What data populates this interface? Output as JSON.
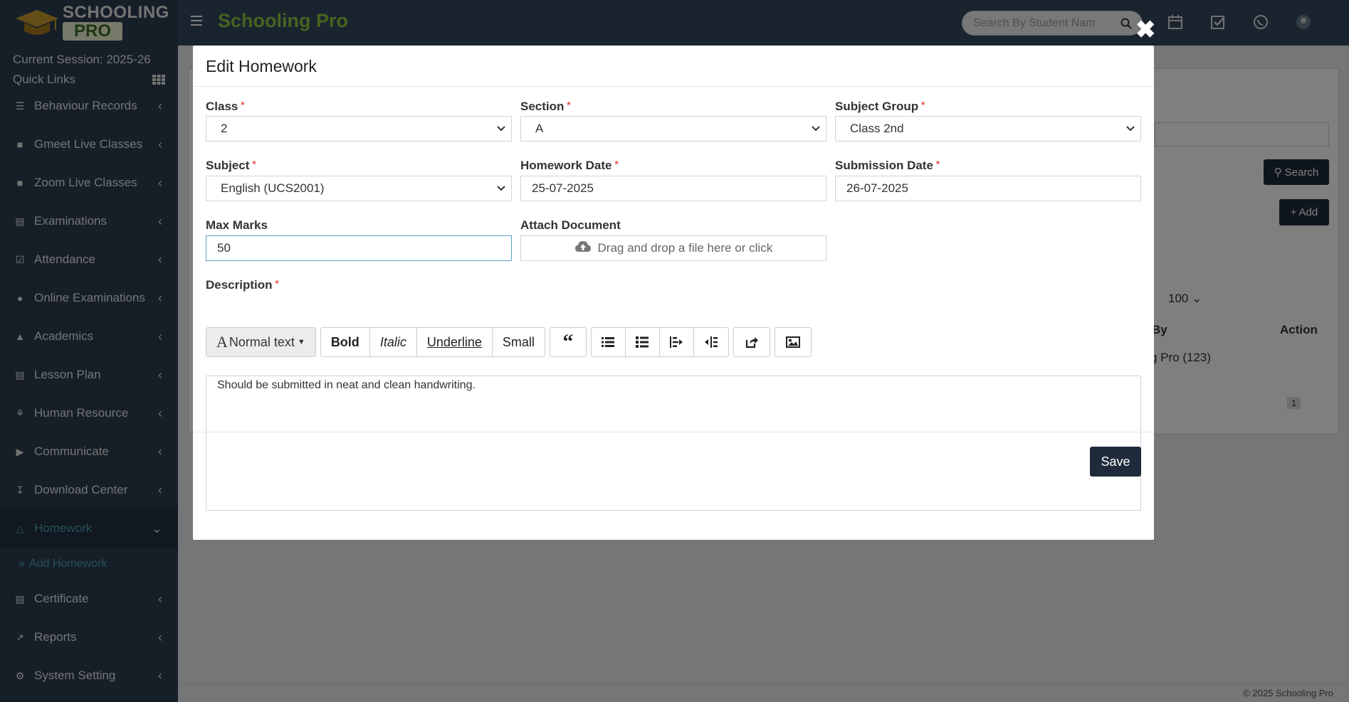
{
  "app": {
    "logo_top": "SCHOOLING",
    "logo_bottom": "PRO",
    "title": "Schooling Pro"
  },
  "topbar": {
    "search_placeholder": "Search By Student Nam",
    "icons": [
      "calendar-icon",
      "check-square-icon",
      "whatsapp-icon",
      "user-avatar-icon"
    ]
  },
  "sidebar": {
    "session": "Current Session: 2025-26",
    "quick_links": "Quick Links",
    "items": [
      {
        "label": "Behaviour Records",
        "icon": "behaviour-icon"
      },
      {
        "label": "Gmeet Live Classes",
        "icon": "video-icon"
      },
      {
        "label": "Zoom Live Classes",
        "icon": "video-icon"
      },
      {
        "label": "Examinations",
        "icon": "map-icon"
      },
      {
        "label": "Attendance",
        "icon": "calendar-check-icon"
      },
      {
        "label": "Online Examinations",
        "icon": "rss-icon"
      },
      {
        "label": "Academics",
        "icon": "graduation-cap-icon"
      },
      {
        "label": "Lesson Plan",
        "icon": "list-alt-icon"
      },
      {
        "label": "Human Resource",
        "icon": "sitemap-icon"
      },
      {
        "label": "Communicate",
        "icon": "bullhorn-icon"
      },
      {
        "label": "Download Center",
        "icon": "download-icon"
      },
      {
        "label": "Homework",
        "icon": "flask-icon"
      },
      {
        "label": "Certificate",
        "icon": "newspaper-icon"
      },
      {
        "label": "Reports",
        "icon": "line-chart-icon"
      },
      {
        "label": "System Setting",
        "icon": "gears-icon"
      }
    ],
    "sub_item": "Add Homework"
  },
  "background": {
    "search_button": "Search",
    "add_button": "Add",
    "page_size": "100",
    "col_by": "By",
    "col_action": "Action",
    "row_by": "g Pro (123)",
    "page_num": "1",
    "footer": "© 2025 Schooling Pro"
  },
  "modal": {
    "title": "Edit Homework",
    "fields": {
      "class": {
        "label": "Class",
        "value": "2"
      },
      "section": {
        "label": "Section",
        "value": "A"
      },
      "subject_group": {
        "label": "Subject Group",
        "value": "Class 2nd"
      },
      "subject": {
        "label": "Subject",
        "value": "English (UCS2001)"
      },
      "homework_date": {
        "label": "Homework Date",
        "value": "25-07-2025"
      },
      "submission_date": {
        "label": "Submission Date",
        "value": "26-07-2025"
      },
      "max_marks": {
        "label": "Max Marks",
        "value": "50"
      },
      "attach_document": {
        "label": "Attach Document",
        "dropzone_text": "Drag and drop a file here or click"
      },
      "description": {
        "label": "Description",
        "value": "Should be submitted in neat and clean handwriting."
      }
    },
    "required_mark": "*",
    "toolbar": {
      "normal_text": "Normal text",
      "bold": "Bold",
      "italic": "Italic",
      "underline": "Underline",
      "small": "Small"
    },
    "save_label": "Save"
  },
  "colors": {
    "sidebar_bg": "#2c3e50",
    "brand_green": "#8fc63f",
    "primary_button": "#1f2a3a",
    "required_red": "#e74c3c",
    "active_link": "#4aa3b7"
  }
}
